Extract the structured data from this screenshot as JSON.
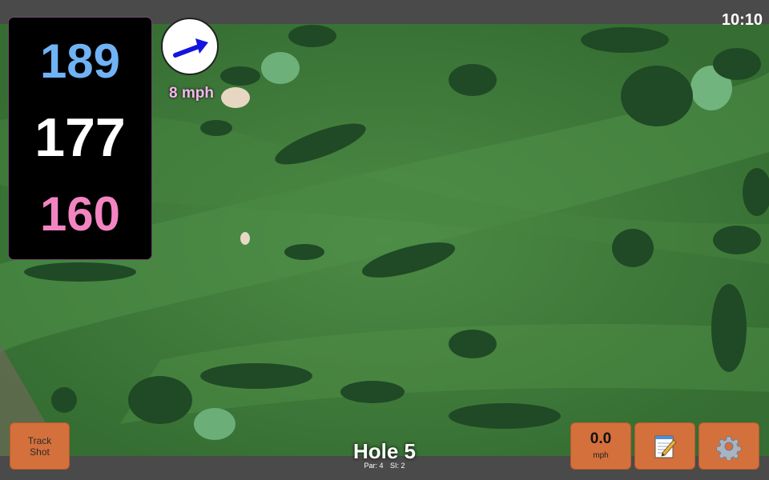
{
  "status_bar": {
    "time": "10:10"
  },
  "yardages": {
    "back": {
      "value": "189",
      "color": "#6fb3f5"
    },
    "middle": {
      "value": "177",
      "color": "#ffffff"
    },
    "front": {
      "value": "160",
      "color": "#f384c2"
    }
  },
  "wind": {
    "speed_label": "8 mph",
    "speed_color": "#f6b6f0",
    "arrow_color": "#1414e0",
    "arrow_icon": "wind-direction-arrow-icon"
  },
  "hole": {
    "title": "Hole 5",
    "par_label": "Par: 4",
    "si_label": "SI: 2"
  },
  "buttons": {
    "track_shot_line1": "Track",
    "track_shot_line2": "Shot",
    "speed_value": "0.0",
    "speed_unit": "mph",
    "notes_icon": "notepad-icon",
    "settings_icon": "gear-icon",
    "accent_color": "#d4703c"
  },
  "map": {
    "description_icon": "satellite-course-map"
  }
}
